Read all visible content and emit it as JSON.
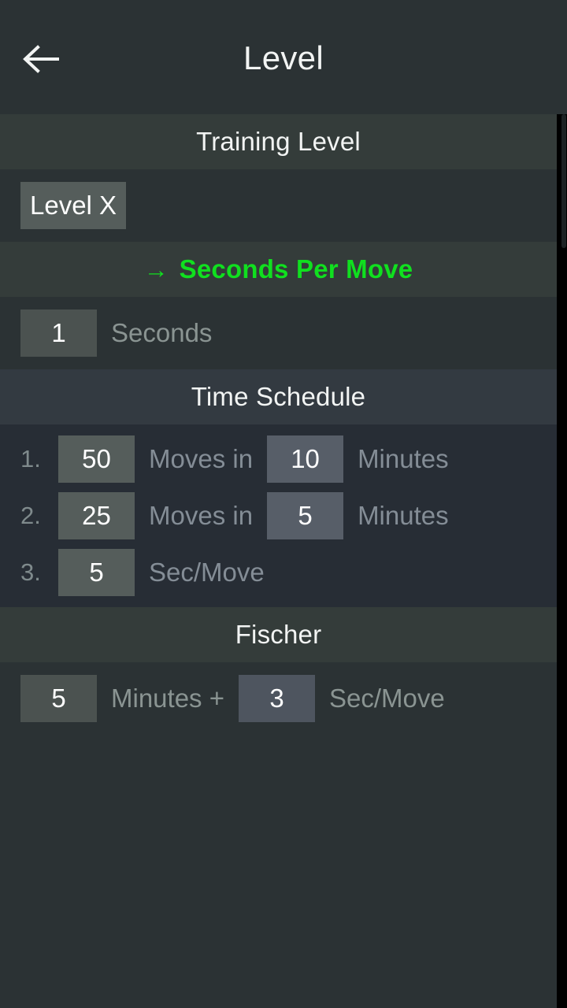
{
  "appbar": {
    "back_icon": "arrow-left-icon",
    "title": "Level"
  },
  "scrollbar": {
    "visible": true
  },
  "sections": {
    "training_level": {
      "header": "Training Level",
      "active": false,
      "level_button": "Level X"
    },
    "seconds_per_move": {
      "header": "Seconds Per Move",
      "arrow_glyph": "→",
      "active": true,
      "accent_color": "#10e01f",
      "value": "1",
      "unit_label": "Seconds"
    },
    "time_schedule": {
      "header": "Time Schedule",
      "active": false,
      "rows": [
        {
          "index": "1.",
          "moves": "50",
          "moves_label": "Moves in",
          "minutes": "10",
          "minutes_label": "Minutes"
        },
        {
          "index": "2.",
          "moves": "25",
          "moves_label": "Moves in",
          "minutes": "5",
          "minutes_label": "Minutes"
        },
        {
          "index": "3.",
          "moves": "5",
          "moves_label": "Sec/Move",
          "minutes": "",
          "minutes_label": ""
        }
      ]
    },
    "fischer": {
      "header": "Fischer",
      "active": false,
      "minutes": "5",
      "minutes_label": "Minutes +",
      "increment": "3",
      "increment_label": "Sec/Move"
    }
  },
  "colors": {
    "background": "#2b3234",
    "header_band": "#343c3a",
    "header_band_blue": "#333a41",
    "body_blue": "#272d35",
    "chip": "#555d5b",
    "chip_blue": "#575e68",
    "accent_green": "#10e01f",
    "text_primary": "#f2f4f3",
    "text_muted": "#8a9492"
  }
}
